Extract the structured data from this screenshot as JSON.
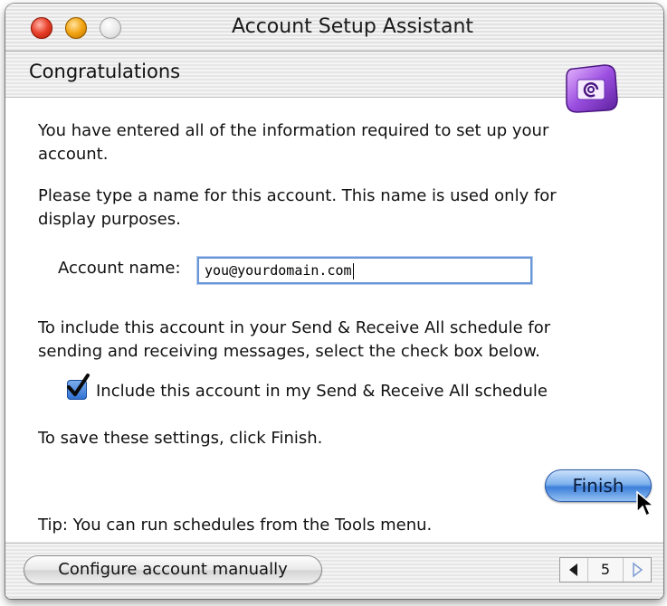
{
  "window": {
    "title": "Account Setup Assistant",
    "heading": "Congratulations",
    "app_icon": "entourage-mail-icon"
  },
  "body": {
    "intro": "You have entered all of the information required to set up your account.",
    "name_instructions": "Please type a name for this account. This name is used only for display purposes.",
    "account_name_label": "Account name:",
    "account_name_value": "you@yourdomain.com",
    "schedule_instructions": "To include this account in your Send & Receive All schedule for sending and receiving messages, select the check box below.",
    "include_checkbox_label": "Include this account in my Send & Receive All schedule",
    "include_checked": true,
    "save_instructions": "To save these settings, click Finish.",
    "finish_label": "Finish",
    "tip": "Tip: You can run schedules from the Tools menu."
  },
  "footer": {
    "manual_label": "Configure account manually",
    "page_number": "5"
  },
  "colors": {
    "accent": "#3c7fda",
    "field_border": "#6a97d6",
    "close": "#e8402a",
    "minimize": "#f3a513"
  }
}
